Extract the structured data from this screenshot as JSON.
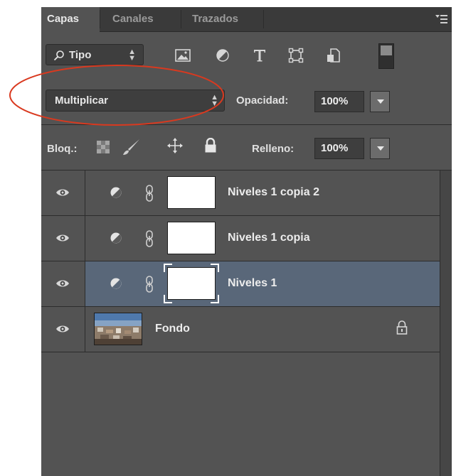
{
  "tabs": [
    {
      "label": "Capas",
      "active": true
    },
    {
      "label": "Canales",
      "active": false
    },
    {
      "label": "Trazados",
      "active": false
    }
  ],
  "filter": {
    "label": "Tipo"
  },
  "filter_icons": [
    "image-filter-icon",
    "adjustment-filter-icon",
    "type-filter-icon",
    "shape-filter-icon",
    "smart-object-filter-icon"
  ],
  "blend_mode": {
    "value": "Multiplicar"
  },
  "opacity": {
    "label": "Opacidad:",
    "value": "100%"
  },
  "lock": {
    "label": "Bloq.:"
  },
  "fill": {
    "label": "Relleno:",
    "value": "100%"
  },
  "layers": [
    {
      "name": "Niveles 1 copia 2",
      "type": "adjustment",
      "selected": false
    },
    {
      "name": "Niveles 1 copia",
      "type": "adjustment",
      "selected": false
    },
    {
      "name": "Niveles 1",
      "type": "adjustment",
      "selected": true
    },
    {
      "name": "Fondo",
      "type": "background",
      "selected": false,
      "locked": true
    }
  ],
  "colors": {
    "panel_bg": "#535353",
    "selected_row": "#596779",
    "annotation": "#d9391f"
  }
}
